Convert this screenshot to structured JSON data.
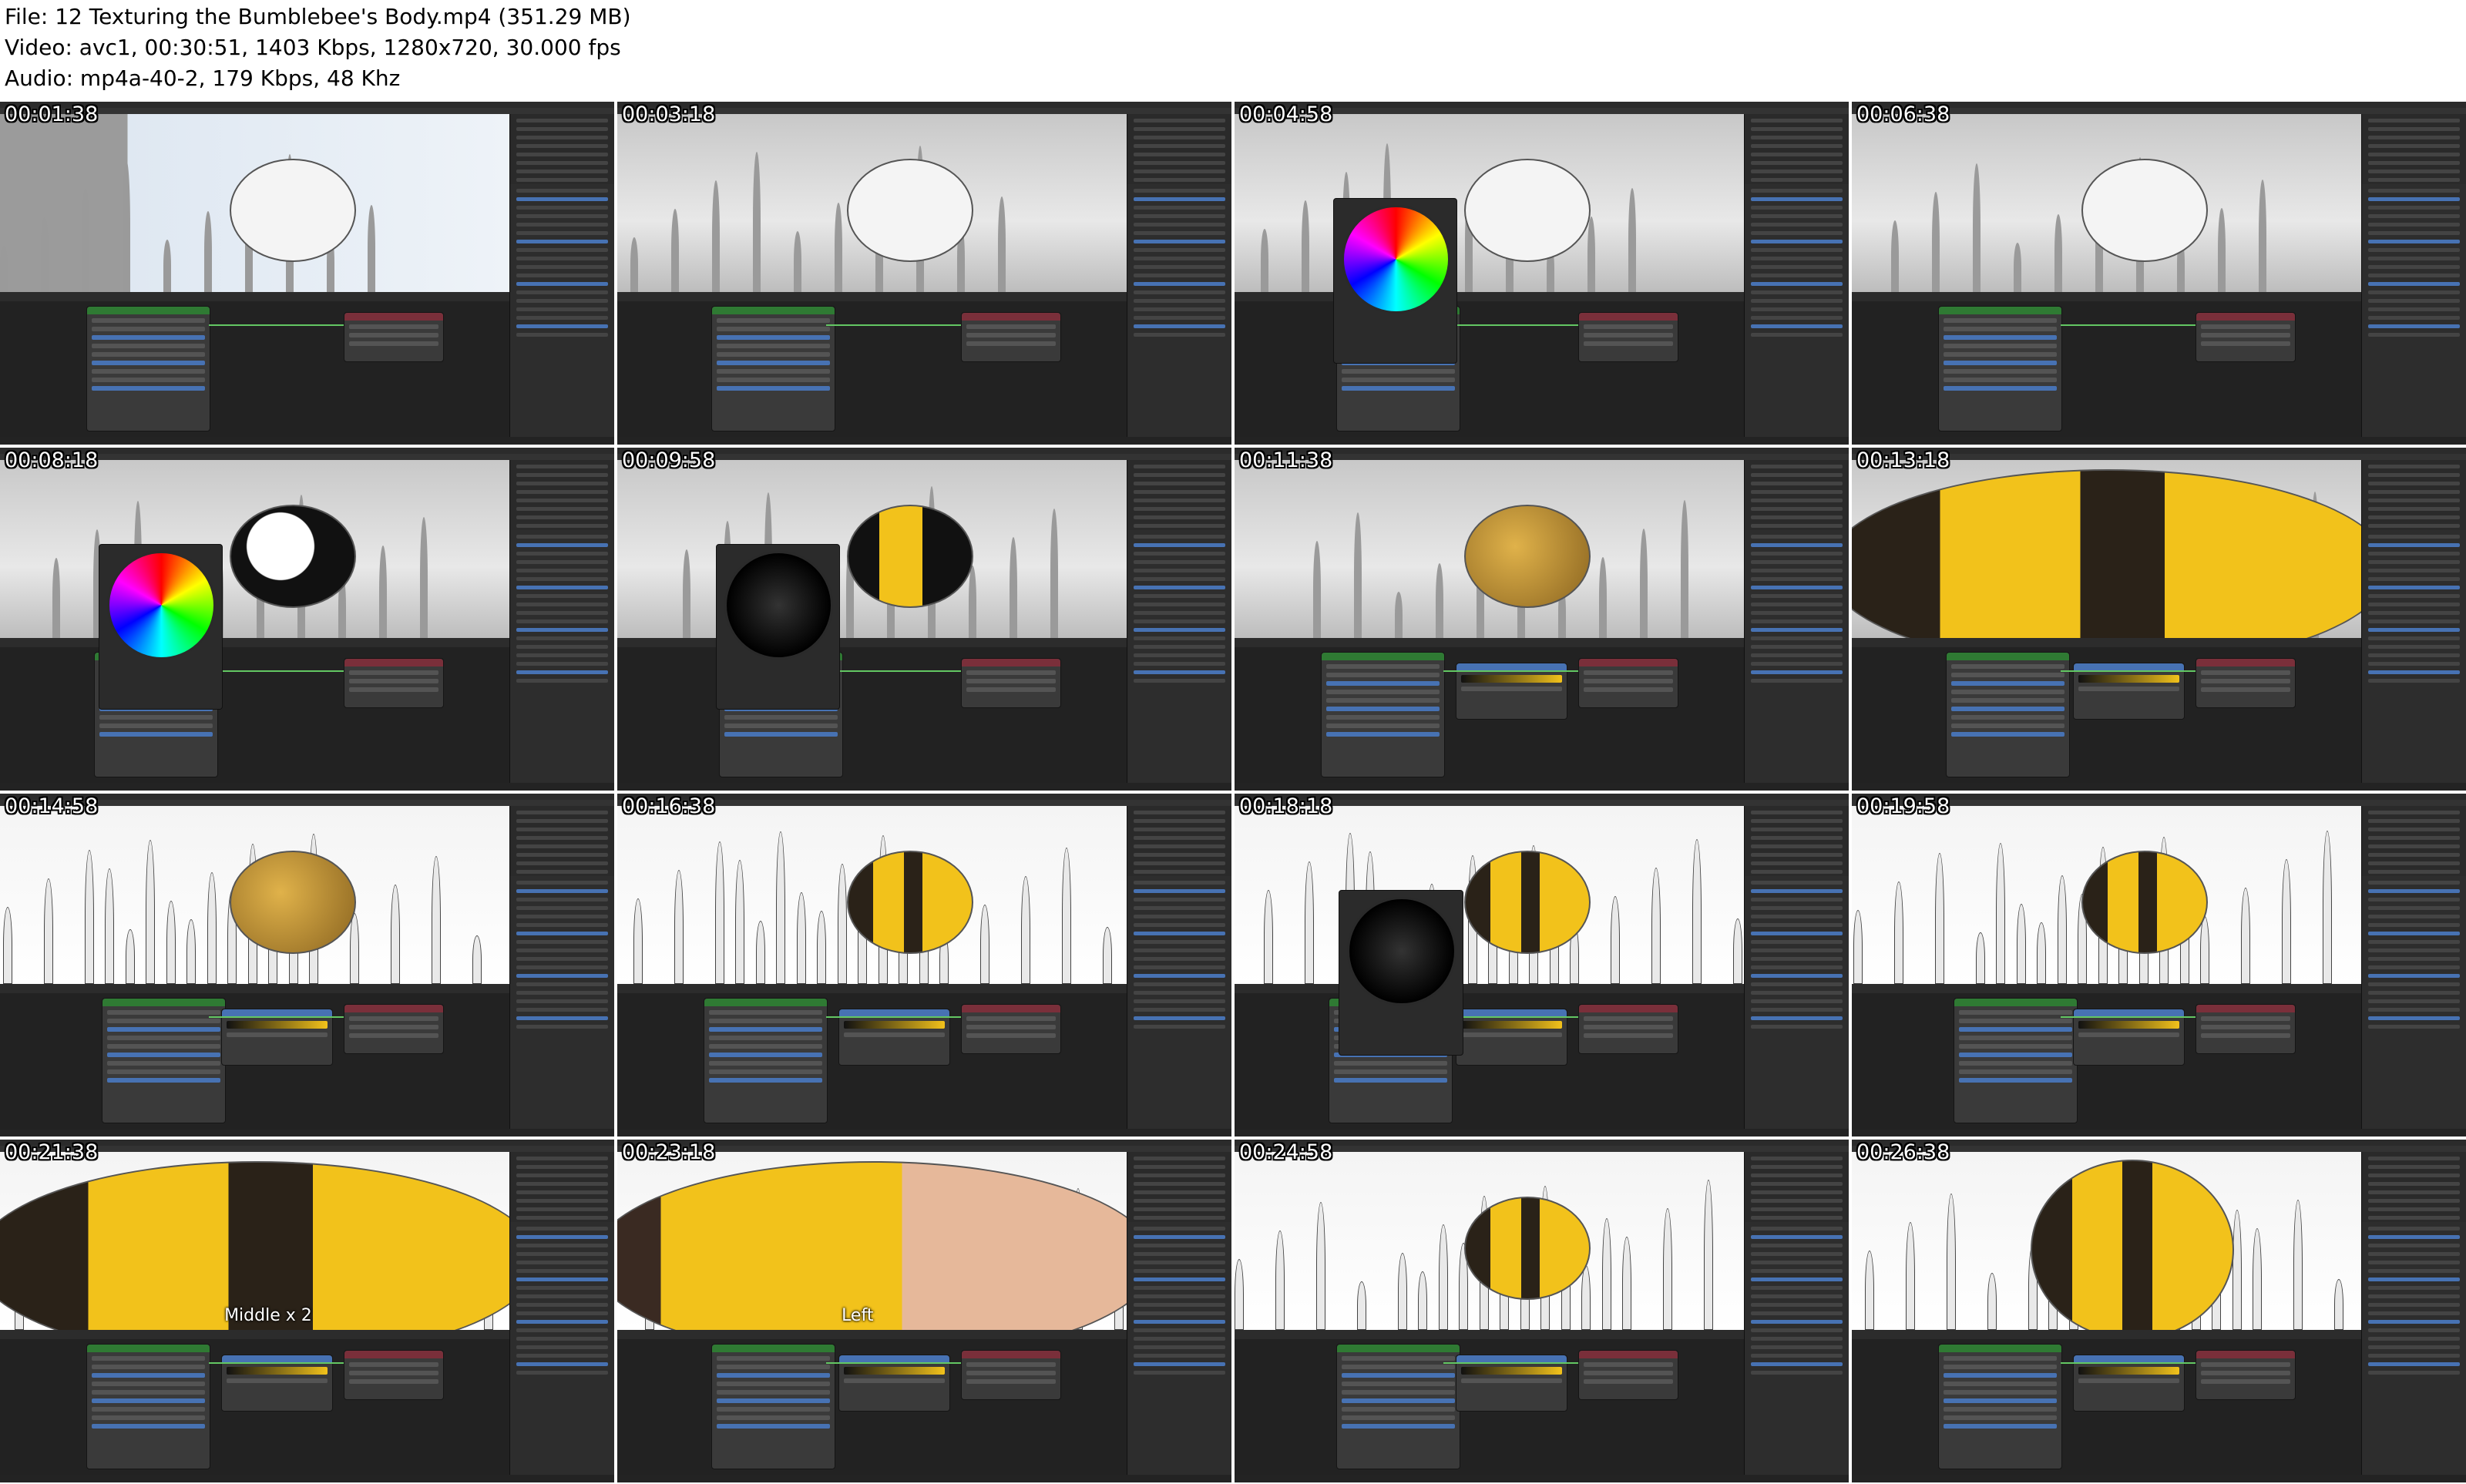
{
  "header": {
    "file_line": "File: 12 Texturing the Bumblebee's Body.mp4 (351.29 MB)",
    "video_line": "Video: avc1, 00:30:51, 1403 Kbps, 1280x720, 30.000 fps",
    "audio_line": "Audio: mp4a-40-2, 179 Kbps, 48 Khz"
  },
  "thumbnails": [
    {
      "timestamp": "00:01:38"
    },
    {
      "timestamp": "00:03:18"
    },
    {
      "timestamp": "00:04:58"
    },
    {
      "timestamp": "00:06:38"
    },
    {
      "timestamp": "00:08:18"
    },
    {
      "timestamp": "00:09:58"
    },
    {
      "timestamp": "00:11:38"
    },
    {
      "timestamp": "00:13:18"
    },
    {
      "timestamp": "00:14:58"
    },
    {
      "timestamp": "00:16:38"
    },
    {
      "timestamp": "00:18:18"
    },
    {
      "timestamp": "00:19:58"
    },
    {
      "timestamp": "00:21:38",
      "overlay": "Middle x 2"
    },
    {
      "timestamp": "00:23:18",
      "overlay": "Left"
    },
    {
      "timestamp": "00:24:58"
    },
    {
      "timestamp": "00:26:38"
    }
  ],
  "colors": {
    "blender_bg": "#1e1e1e",
    "bee_yellow": "#f2c21b",
    "bee_dark": "#2a2218",
    "accent_blue": "#4772b3",
    "node_green": "#2f7a33",
    "node_red": "#7a2f3a"
  }
}
